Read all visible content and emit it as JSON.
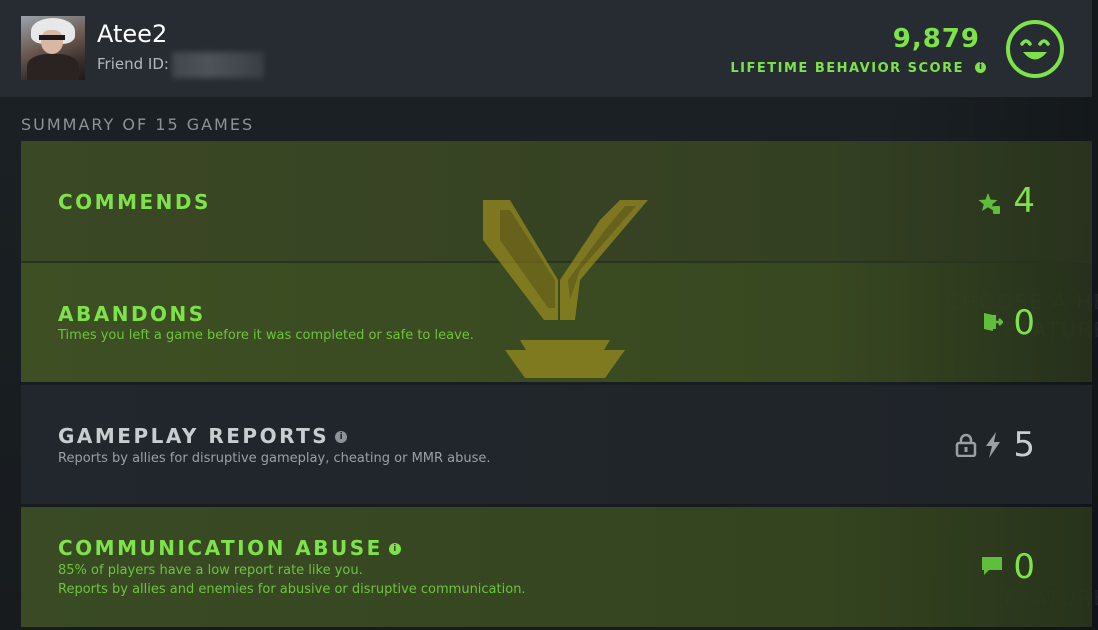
{
  "profile": {
    "username": "Atee2",
    "friend_id_label": "Friend ID:"
  },
  "behavior": {
    "score": "9,879",
    "label": "LIFETIME BEHAVIOR SCORE",
    "info_glyph": "i",
    "mood_icon": "smiley-face-icon"
  },
  "summary": {
    "title": "SUMMARY OF 15 GAMES"
  },
  "rows": {
    "commends": {
      "title": "COMMENDS",
      "value": "4",
      "icon": "star-thumb-icon"
    },
    "abandons": {
      "title": "ABANDONS",
      "description": "Times you left a game before it was completed or safe to leave.",
      "value": "0",
      "icon": "exit-door-icon"
    },
    "gameplay_reports": {
      "title": "GAMEPLAY REPORTS",
      "info_glyph": "i",
      "description": "Reports by allies for disruptive gameplay, cheating or MMR abuse.",
      "value": "5",
      "icons": [
        "lock-icon",
        "lightning-icon"
      ]
    },
    "communication_abuse": {
      "title": "COMMUNICATION ABUSE",
      "info_glyph": "i",
      "description_line1": "85% of players have a low report rate like you.",
      "description_line2": "Reports by allies and enemies for abusive or disruptive communication.",
      "value": "0",
      "icon": "chat-bubble-icon"
    }
  },
  "colors": {
    "accent_green": "#7ee34a",
    "header_bg": "#262c31",
    "crest_gold": "#b9a21f"
  }
}
